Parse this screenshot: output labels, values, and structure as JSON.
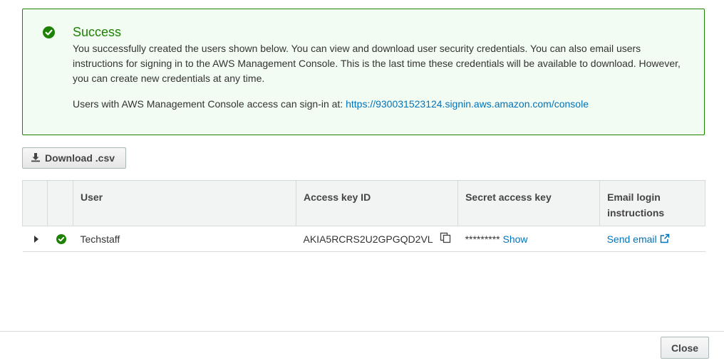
{
  "alert": {
    "icon": "check-circle-icon",
    "title": "Success",
    "message": "You successfully created the users shown below. You can view and download user security credentials. You can also email users instructions for signing in to the AWS Management Console. This is the last time these credentials will be available to download. However, you can create new credentials at any time.",
    "signin_text": "Users with AWS Management Console access can sign-in at:",
    "signin_url": "https://930031523124.signin.aws.amazon.com/console",
    "color": "#1d8102"
  },
  "toolbar": {
    "download_icon": "download-icon",
    "download_label": "Download .csv"
  },
  "table": {
    "headers": {
      "user": "User",
      "access_key_id": "Access key ID",
      "secret_access_key": "Secret access key",
      "email_login_instructions": "Email login instructions"
    },
    "rows": [
      {
        "status_icon": "check-circle-icon",
        "user": "Techstaff",
        "access_key_id": "AKIA5RCRS2U2GPGQD2VL",
        "secret_mask": "*********",
        "show_label": "Show",
        "email_label": "Send email",
        "email_icon": "external-link-icon"
      }
    ]
  },
  "footer": {
    "close_label": "Close"
  },
  "colors": {
    "link": "#0073bb",
    "success": "#1d8102"
  }
}
